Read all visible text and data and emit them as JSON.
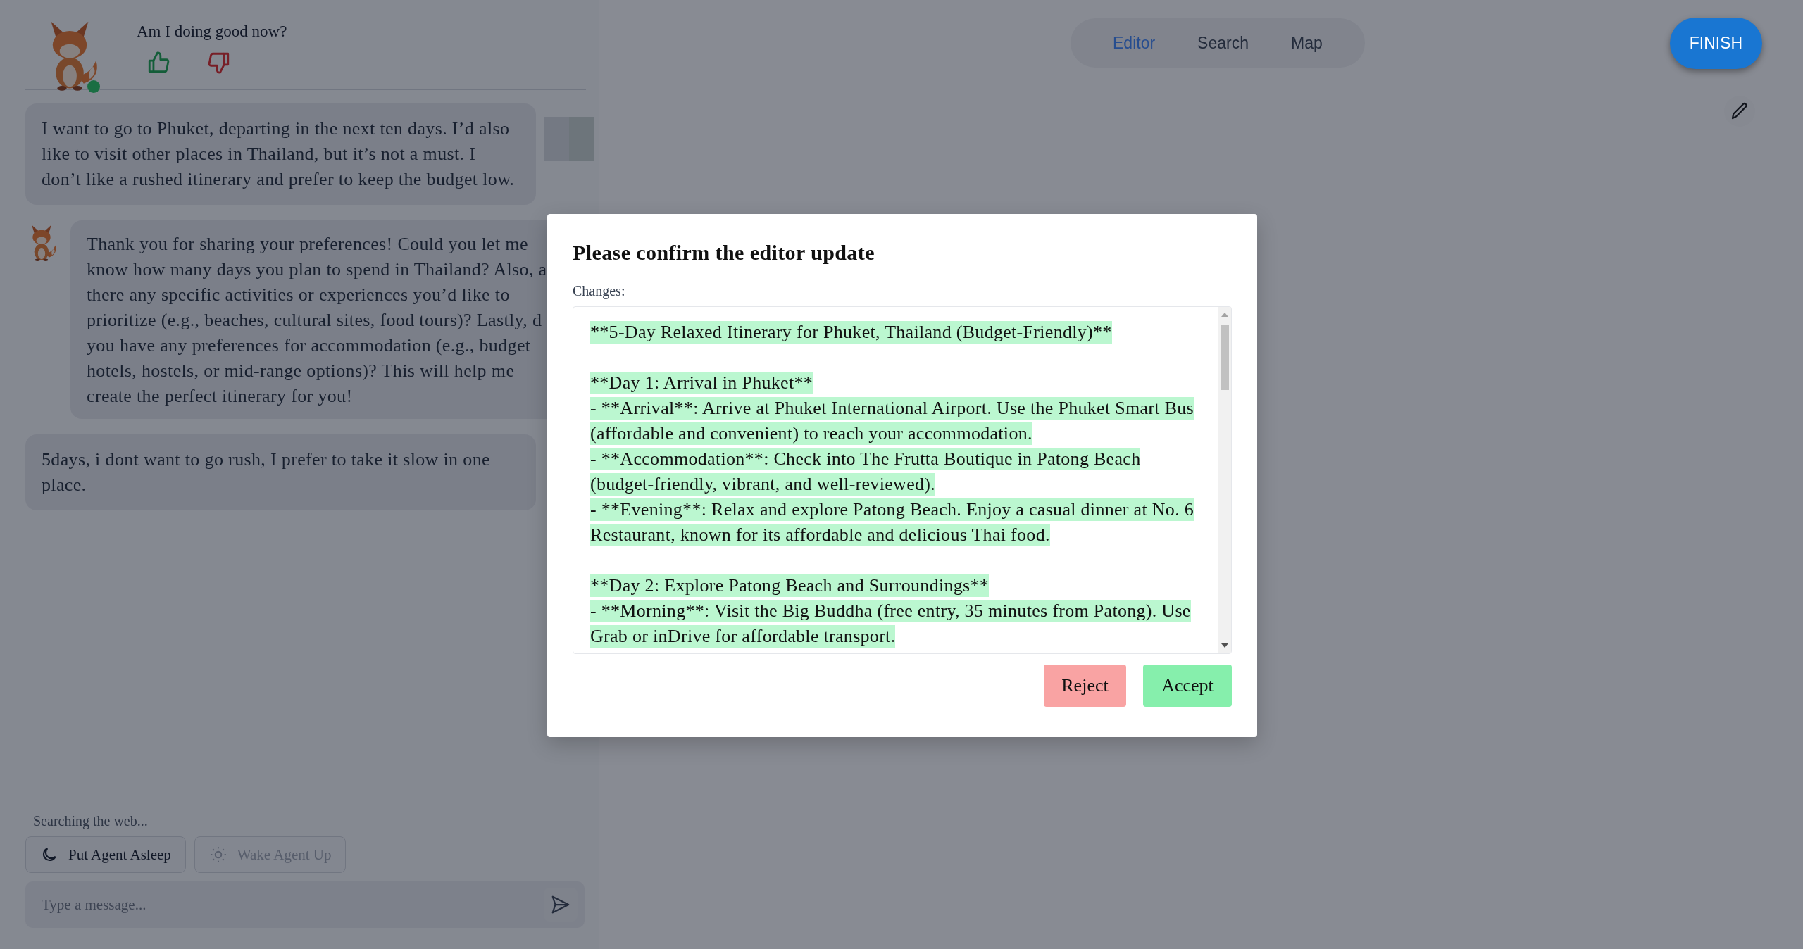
{
  "feedback": {
    "question": "Am I doing good now?"
  },
  "agent": {
    "online": true
  },
  "messages": [
    {
      "kind": "user",
      "text": "I want to go to Phuket, departing in the next ten days. I’d also like to visit other places in Thailand, but it’s not a must. I don’t like a rushed itinerary and prefer to keep the budget low."
    },
    {
      "kind": "assistant",
      "text": "Thank you for sharing your preferences! Could you let me\nknow how many days you plan to spend in Thailand? Also, a\nthere any specific activities or experiences you’d like to\nprioritize (e.g., beaches, cultural sites, food tours)? Lastly, d\nyou have any preferences for accommodation (e.g., budget\nhotels, hostels, or mid-range options)? This will help me\ncreate the perfect itinerary for you!"
    },
    {
      "kind": "user",
      "text": "5days, i dont want to go rush, I prefer to take it slow in one place."
    }
  ],
  "status": "Searching the web...",
  "controls": [
    {
      "kind": "sleep",
      "label": "Put Agent Asleep",
      "disabled": false
    },
    {
      "kind": "wake",
      "label": "Wake Agent Up",
      "disabled": true
    }
  ],
  "composer": {
    "placeholder": "Type a message..."
  },
  "tabs": [
    {
      "label": "Editor",
      "selected": true
    },
    {
      "label": "Search",
      "selected": false
    },
    {
      "label": "Map",
      "selected": false
    }
  ],
  "finish_button": "FINISH",
  "dialog": {
    "title": "Please confirm the editor update",
    "changes_label": "Changes:",
    "sections": [
      {
        "lines": [
          "**5-Day Relaxed Itinerary for Phuket, Thailand (Budget-Friendly)**"
        ]
      },
      {
        "lines": [
          "**Day 1: Arrival in Phuket**",
          "- **Arrival**: Arrive at Phuket International Airport. Use the Phuket Smart Bus",
          "(affordable and convenient) to reach your accommodation.",
          "- **Accommodation**: Check into The Frutta Boutique in Patong Beach",
          "(budget-friendly, vibrant, and well-reviewed).",
          "- **Evening**: Relax and explore Patong Beach. Enjoy a casual dinner at No. 6",
          "Restaurant, known for its affordable and delicious Thai food."
        ]
      },
      {
        "lines": [
          "**Day 2: Explore Patong Beach and Surroundings**",
          "- **Morning**: Visit the Big Buddha (free entry, 35 minutes from Patong). Use",
          "Grab or inDrive for affordable transport."
        ]
      }
    ],
    "buttons": [
      {
        "kind": "reject",
        "label": "Reject"
      },
      {
        "kind": "accept",
        "label": "Accept"
      }
    ]
  }
}
